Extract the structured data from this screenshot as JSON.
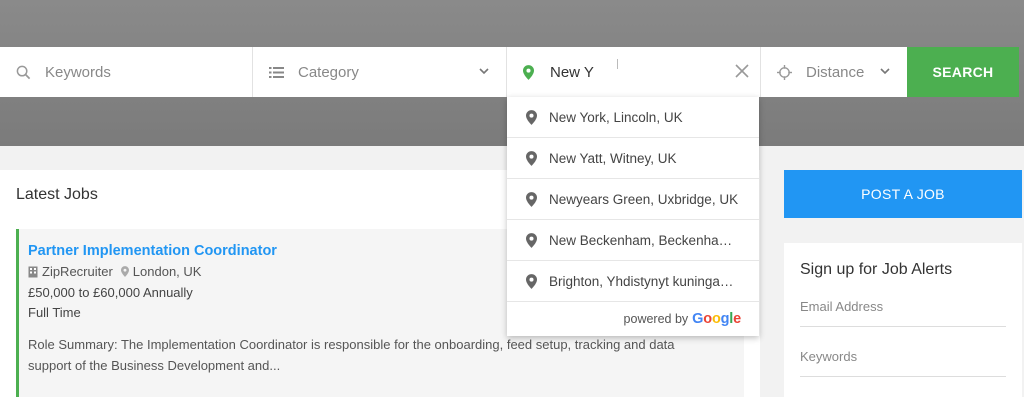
{
  "search": {
    "keywords_placeholder": "Keywords",
    "category_label": "Category",
    "location_value": "New Y",
    "distance_label": "Distance",
    "search_button": "SEARCH"
  },
  "autocomplete": {
    "items": [
      "New York, Lincoln, UK",
      "New Yatt, Witney, UK",
      "Newyears Green, Uxbridge, UK",
      "New Beckenham, Beckenham, …",
      "Brighton, Yhdistynyt kuningask…"
    ],
    "powered_by": "powered by",
    "google": "Google"
  },
  "latest_jobs": {
    "heading": "Latest Jobs",
    "job": {
      "title": "Partner Implementation Coordinator",
      "company": "ZipRecruiter",
      "location": "London, UK",
      "salary": "£50,000 to £60,000 Annually",
      "type": "Full Time",
      "summary": "Role Summary: The Implementation Coordinator is responsible for the onboarding, feed setup, tracking and data support of the Business Development and..."
    }
  },
  "sidebar": {
    "post_job_button": "POST A JOB",
    "alerts_title": "Sign up for Job Alerts",
    "email_placeholder": "Email Address",
    "keywords_placeholder": "Keywords"
  },
  "colors": {
    "accent_green": "#4caf50",
    "accent_blue": "#2196f3"
  },
  "icons": [
    "search-icon",
    "list-icon",
    "map-pin-icon",
    "chevron-down-icon",
    "close-icon",
    "crosshair-icon",
    "building-icon"
  ]
}
